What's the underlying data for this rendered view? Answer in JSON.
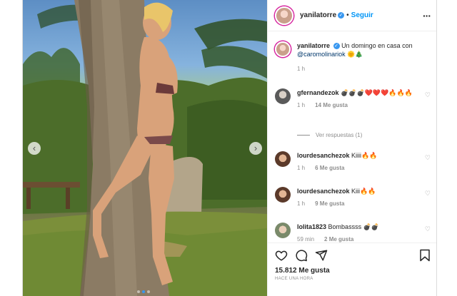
{
  "post": {
    "username": "yanilatorre",
    "follow_label": "Seguir",
    "caption": "Un domingo en casa con ",
    "caption_mention": "@caromolinariok",
    "caption_emoji": "🌞🎄",
    "caption_time": "1 h"
  },
  "comments": [
    {
      "user": "gfernandezok",
      "text": "💣💣💣❤️❤️❤️🔥🔥🔥",
      "time": "1 h",
      "likes": "14 Me gusta"
    },
    {
      "user": "lourdesanchezok",
      "text": "Kiiii🔥🔥",
      "time": "1 h",
      "likes": "6 Me gusta"
    },
    {
      "user": "lourdesanchezok",
      "text": "Kiii🔥🔥",
      "time": "1 h",
      "likes": "9 Me gusta"
    },
    {
      "user": "lolita1823",
      "text": "Bombassss 💣💣",
      "time": "59 min",
      "likes": "2 Me gusta"
    }
  ],
  "replies_label": "Ver respuestas (1)",
  "actions": {
    "likes": "15.812 Me gusta",
    "time_ago": "Hace una hora"
  },
  "icons": {
    "heart": "heart-icon",
    "comment": "comment-icon",
    "share": "share-icon",
    "save": "bookmark-icon",
    "prev": "chevron-left-icon",
    "next": "chevron-right-icon"
  },
  "colors": {
    "link": "#0095f6",
    "verified": "#3897f0",
    "muted": "#8e8e8e"
  }
}
